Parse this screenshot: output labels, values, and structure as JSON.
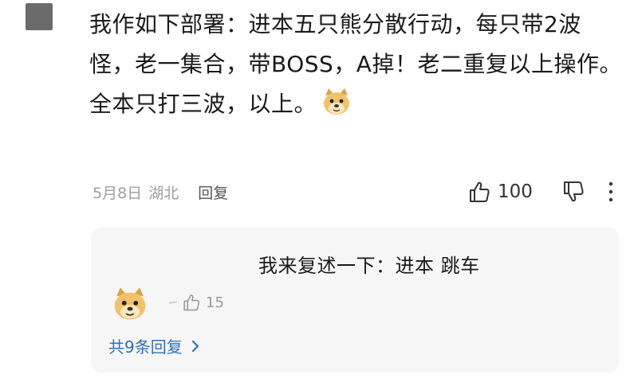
{
  "comment": {
    "lines": [
      "我作如下部署：进本五只熊分散行动，每只带2波怪，老一集合，带BOSS，A掉！老二重复以上操作。",
      "全本只打三波，以上。"
    ],
    "emoji_icon": "doge-emoji-icon",
    "date": "5月8日",
    "location": "湖北",
    "reply_label": "回复",
    "like_count": "100"
  },
  "reply": {
    "text": "我来复述一下：进本 跳车",
    "emoji_icon": "doge-emoji-icon",
    "like_count": "15",
    "view_all_label": "共9条回复"
  },
  "colors": {
    "link": "#2f6fbf",
    "meta": "#9e9e9e",
    "reply_bg": "#f6f6f6"
  }
}
